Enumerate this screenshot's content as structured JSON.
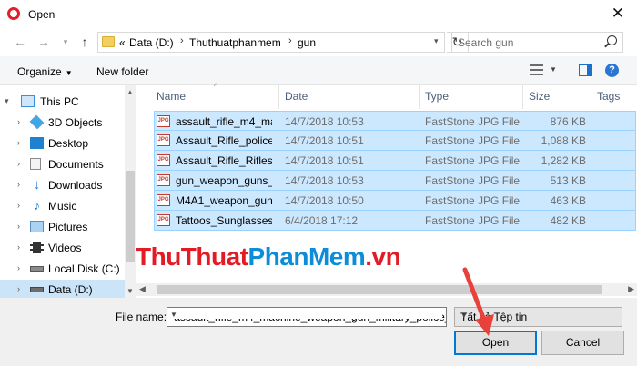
{
  "window": {
    "title": "Open",
    "accent": "#0078d7"
  },
  "nav": {
    "breadcrumbs": [
      "«",
      "Data (D:)",
      "Thuthuatphanmem",
      "gun"
    ],
    "search_placeholder": "Search gun"
  },
  "toolbar": {
    "organize": "Organize",
    "new_folder": "New folder"
  },
  "sidebar": {
    "items": [
      {
        "label": "This PC",
        "icon": "monitor-icon"
      },
      {
        "label": "3D Objects",
        "icon": "cube-icon"
      },
      {
        "label": "Desktop",
        "icon": "desktop-icon"
      },
      {
        "label": "Documents",
        "icon": "documents-icon"
      },
      {
        "label": "Downloads",
        "icon": "download-arrow-icon"
      },
      {
        "label": "Music",
        "icon": "music-note-icon"
      },
      {
        "label": "Pictures",
        "icon": "pictures-icon"
      },
      {
        "label": "Videos",
        "icon": "film-icon"
      },
      {
        "label": "Local Disk (C:)",
        "icon": "drive-icon"
      },
      {
        "label": "Data (D:)",
        "icon": "drive-icon",
        "selected": true
      }
    ]
  },
  "files": {
    "columns": [
      "Name",
      "Date",
      "Type",
      "Size",
      "Tags"
    ],
    "rows": [
      {
        "name": "assault_rifle_m4_ma...",
        "date": "14/7/2018 10:53",
        "type": "FastStone JPG File",
        "size": "876 KB"
      },
      {
        "name": "Assault_Rifle_police...",
        "date": "14/7/2018 10:51",
        "type": "FastStone JPG File",
        "size": "1,088 KB"
      },
      {
        "name": "Assault_Rifle_Rifles_...",
        "date": "14/7/2018 10:51",
        "type": "FastStone JPG File",
        "size": "1,282 KB"
      },
      {
        "name": "gun_weapon_guns_...",
        "date": "14/7/2018 10:53",
        "type": "FastStone JPG File",
        "size": "513 KB"
      },
      {
        "name": "M4A1_weapon_gun...",
        "date": "14/7/2018 10:50",
        "type": "FastStone JPG File",
        "size": "463 KB"
      },
      {
        "name": "Tattoos_Sunglasses...",
        "date": "6/4/2018 17:12",
        "type": "FastStone JPG File",
        "size": "482 KB"
      }
    ],
    "icon_label": "JPG"
  },
  "footer": {
    "file_name_label": "File name:",
    "file_name_value": "\"assault_rifle_m4_machine_weapon_gun_military_police_",
    "file_type_value": "Tất cả Tệp tin",
    "open_label": "Open",
    "cancel_label": "Cancel"
  },
  "watermark": {
    "part1": "ThuThuat",
    "part2": "PhanMem",
    "part3": ".vn"
  }
}
